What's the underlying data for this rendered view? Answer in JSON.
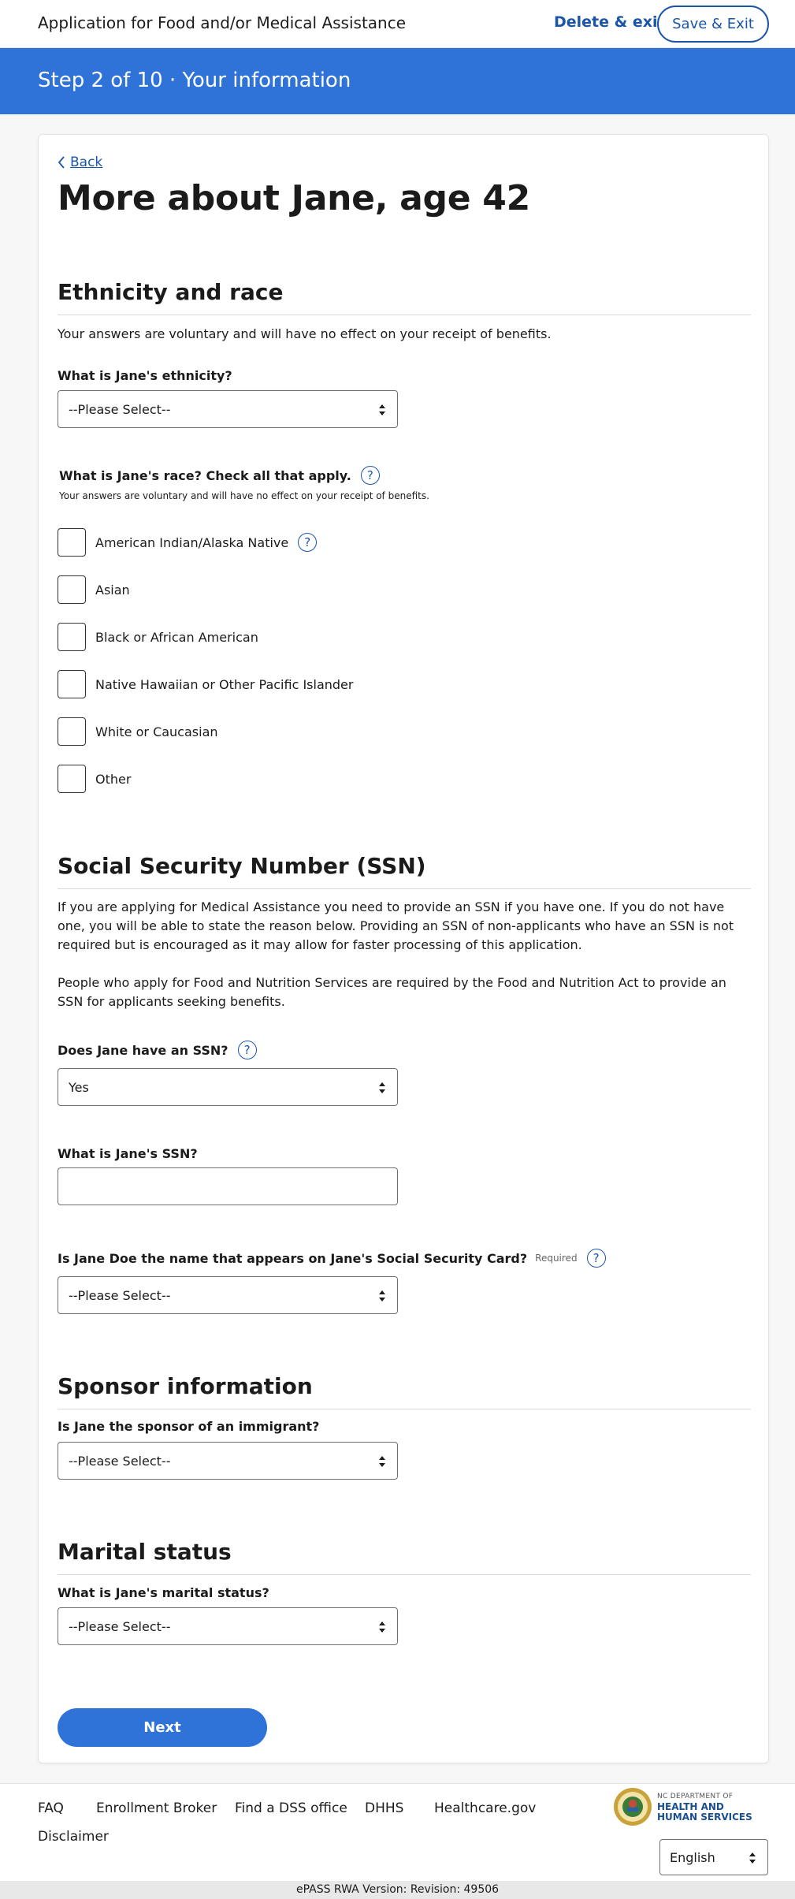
{
  "header": {
    "app_title": "Application for Food and/or Medical Assistance",
    "delete_exit": "Delete & exit",
    "save_exit": "Save & Exit"
  },
  "step": {
    "text": "Step 2 of 10 · Your information"
  },
  "page": {
    "back": "Back",
    "title": "More about Jane, age 42"
  },
  "ethnicity": {
    "title": "Ethnicity and race",
    "voluntary_note": "Your answers are voluntary and will have no effect on your receipt of benefits.",
    "ethnicity_label": "What is Jane's ethnicity?",
    "ethnicity_value": "--Please Select--",
    "race_label": "What is Jane's race? Check all that apply.",
    "race_note": "Your answers are voluntary and will have no effect on your receipt of benefits.",
    "race_options": [
      "American Indian/Alaska Native",
      "Asian",
      "Black or African American",
      "Native Hawaiian or Other Pacific Islander",
      "White or Caucasian",
      "Other"
    ]
  },
  "ssn": {
    "title": "Social Security Number (SSN)",
    "para1": "If you are applying for Medical Assistance you need to provide an SSN if you have one. If you do not have one, you will be able to state the reason below. Providing an SSN of non-applicants who have an SSN is not required but is encouraged as it may allow for faster processing of this application.",
    "para2": "People who apply for Food and Nutrition Services are required by the Food and Nutrition Act to provide an SSN for applicants seeking benefits.",
    "has_ssn_label": "Does Jane have an SSN?",
    "has_ssn_value": "Yes",
    "ssn_label": "What is Jane's SSN?",
    "ssn_value": "",
    "name_label": "Is Jane Doe the name that appears on Jane's Social Security Card?",
    "required": "Required",
    "name_value": "--Please Select--"
  },
  "sponsor": {
    "title": "Sponsor information",
    "label": "Is Jane the sponsor of an immigrant?",
    "value": "--Please Select--"
  },
  "marital": {
    "title": "Marital status",
    "label": "What is Jane's marital status?",
    "value": "--Please Select--"
  },
  "next_button": "Next",
  "footer": {
    "links": [
      "FAQ",
      "Enrollment Broker",
      "Find a DSS office",
      "DHHS",
      "Healthcare.gov",
      "Disclaimer"
    ],
    "logo_line1": "NC DEPARTMENT OF",
    "logo_line2": "HEALTH AND",
    "logo_line3": "HUMAN SERVICES",
    "language": "English"
  },
  "version": "ePASS RWA Version: Revision: 49506",
  "colors": {
    "primary": "#2f73d9",
    "link": "#1a55a8"
  }
}
